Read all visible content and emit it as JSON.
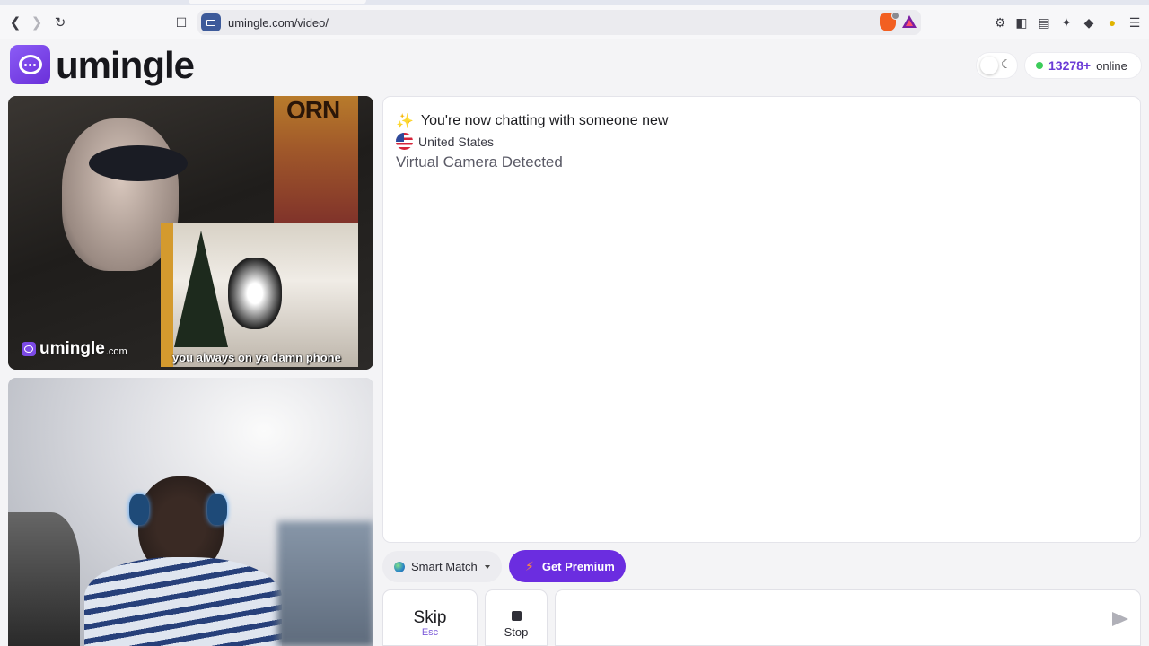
{
  "browser": {
    "url": "umingle.com/video/",
    "icons": [
      "back-icon",
      "forward-icon",
      "reload-icon",
      "bookmark-icon",
      "site-video-icon",
      "brave-shields-icon",
      "brave-rewards-icon",
      "extensions-icon",
      "sidebar-icon",
      "wallet-icon",
      "leo-ai-icon",
      "vpn-icon",
      "profile-icon",
      "menu-icon"
    ]
  },
  "header": {
    "brand": "umingle",
    "online_count": "13278+",
    "online_label": "online"
  },
  "videos": {
    "watermark_brand": "umingle",
    "watermark_tld": ".com",
    "caption": "you always on ya damn phone"
  },
  "chat": {
    "status": "You're now chatting with someone new",
    "country": "United States",
    "warning": "Virtual Camera Detected"
  },
  "controls": {
    "match_mode": "Smart Match",
    "premium_label": "Get Premium",
    "skip_label": "Skip",
    "skip_shortcut": "Esc",
    "stop_label": "Stop",
    "message_placeholder": ""
  },
  "colors": {
    "brand": "#6b2de0",
    "online_dot": "#3ccc5a",
    "count_text": "#6b3bd6"
  }
}
